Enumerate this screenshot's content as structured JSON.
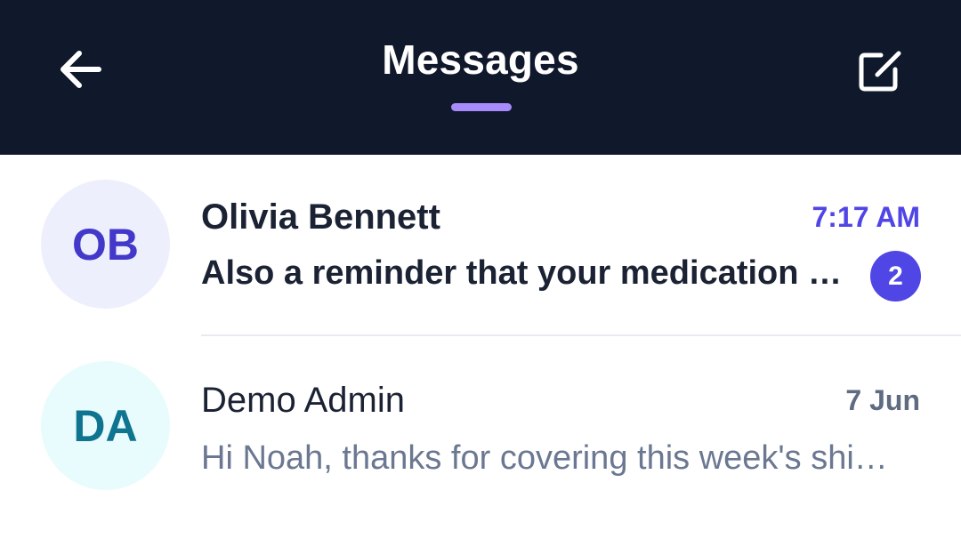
{
  "header": {
    "title": "Messages",
    "back_icon": "arrow-left-icon",
    "compose_icon": "compose-icon",
    "accent_color": "#a78bfa",
    "background_color": "#10182b"
  },
  "conversations": [
    {
      "initials": "OB",
      "name": "Olivia Bennett",
      "time": "7:17 AM",
      "preview": "Also a reminder that your medication c…",
      "unread_count": "2",
      "unread": true,
      "avatar_bg": "#edf0fc",
      "avatar_fg": "#4338ca"
    },
    {
      "initials": "DA",
      "name": "Demo Admin",
      "time": "7 Jun",
      "preview": "Hi Noah, thanks for covering this week's shi…",
      "unread": false,
      "avatar_bg": "#e8fbfd",
      "avatar_fg": "#0e7490"
    }
  ]
}
